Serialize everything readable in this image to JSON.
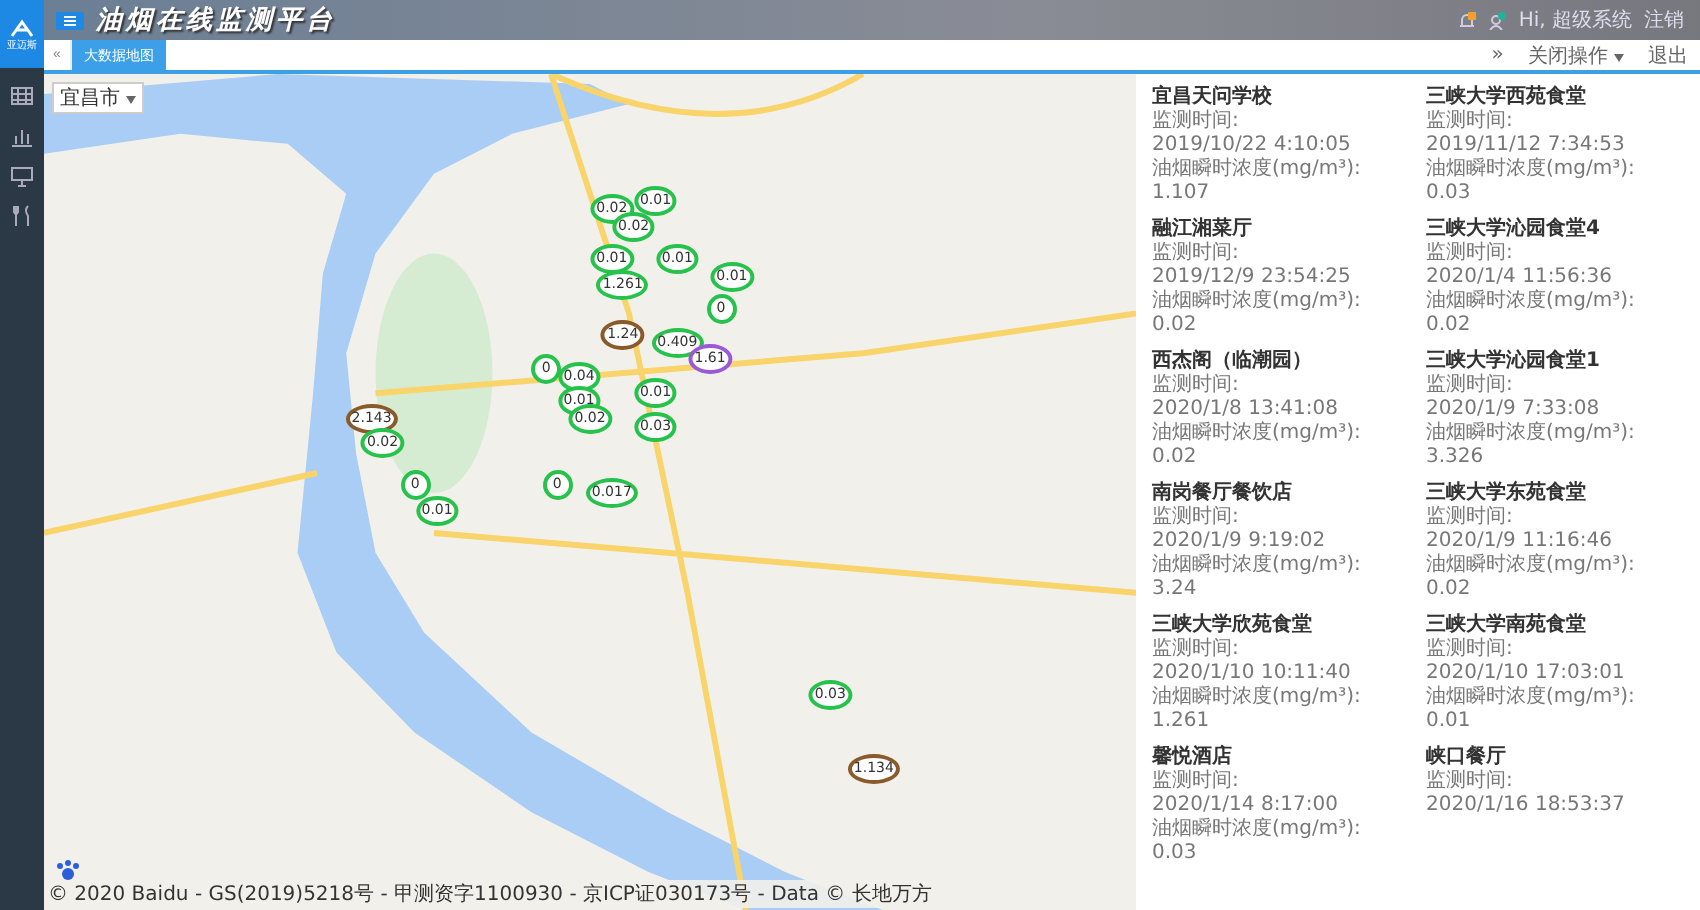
{
  "header": {
    "logo_text": "亚迈斯",
    "title": "油烟在线监测平台",
    "user": "Hi, 超级系统",
    "logout": "注销"
  },
  "tabbar": {
    "collapse": "«",
    "tabs": [
      {
        "label": "大数据地图",
        "selected": true
      }
    ],
    "forward": "»",
    "close_menu": "关闭操作",
    "exit": "退出"
  },
  "map": {
    "city_select": "宜昌市",
    "markers": [
      {
        "value": "0.02",
        "kind": "normal"
      },
      {
        "value": "0.01",
        "kind": "normal"
      },
      {
        "value": "0.02",
        "kind": "normal"
      },
      {
        "value": "0.01",
        "kind": "normal"
      },
      {
        "value": "1.261",
        "kind": "normal"
      },
      {
        "value": "0.01",
        "kind": "normal"
      },
      {
        "value": "0.01",
        "kind": "normal"
      },
      {
        "value": "0",
        "kind": "normal"
      },
      {
        "value": "1.24",
        "kind": "alert"
      },
      {
        "value": "0.409",
        "kind": "normal"
      },
      {
        "value": "1.61",
        "kind": "purple"
      },
      {
        "value": "0",
        "kind": "normal"
      },
      {
        "value": "0.04",
        "kind": "normal"
      },
      {
        "value": "0.01",
        "kind": "normal"
      },
      {
        "value": "0.02",
        "kind": "normal"
      },
      {
        "value": "0.01",
        "kind": "normal"
      },
      {
        "value": "0.03",
        "kind": "normal"
      },
      {
        "value": "2.143",
        "kind": "alert"
      },
      {
        "value": "0.02",
        "kind": "normal"
      },
      {
        "value": "0",
        "kind": "normal"
      },
      {
        "value": "0.01",
        "kind": "normal"
      },
      {
        "value": "0",
        "kind": "normal"
      },
      {
        "value": "0.017",
        "kind": "normal"
      },
      {
        "value": "0.03",
        "kind": "normal"
      },
      {
        "value": "1.134",
        "kind": "alert"
      }
    ],
    "copyright": "© 2020 Baidu - GS(2019)5218号 - 甲测资字1100930 - 京ICP证030173号 - Data © 长地万方"
  },
  "panel": {
    "items": [
      {
        "name": "宜昌天问学校",
        "time_label": "监测时间:",
        "time": "2019/10/22 4:10:05",
        "conc_label": "油烟瞬时浓度(mg/m³):",
        "conc": "1.107"
      },
      {
        "name": "三峡大学西苑食堂",
        "time_label": "监测时间:",
        "time": "2019/11/12 7:34:53",
        "conc_label": "油烟瞬时浓度(mg/m³):",
        "conc": "0.03"
      },
      {
        "name": "融江湘菜厅",
        "time_label": "监测时间:",
        "time": "2019/12/9 23:54:25",
        "conc_label": "油烟瞬时浓度(mg/m³):",
        "conc": "0.02"
      },
      {
        "name": "三峡大学沁园食堂4",
        "time_label": "监测时间:",
        "time": "2020/1/4 11:56:36",
        "conc_label": "油烟瞬时浓度(mg/m³):",
        "conc": "0.02"
      },
      {
        "name": "西杰阁（临潮园）",
        "time_label": "监测时间:",
        "time": "2020/1/8 13:41:08",
        "conc_label": "油烟瞬时浓度(mg/m³):",
        "conc": "0.02"
      },
      {
        "name": "三峡大学沁园食堂1",
        "time_label": "监测时间:",
        "time": "2020/1/9 7:33:08",
        "conc_label": "油烟瞬时浓度(mg/m³):",
        "conc": "3.326"
      },
      {
        "name": "南岗餐厅餐饮店",
        "time_label": "监测时间:",
        "time": "2020/1/9 9:19:02",
        "conc_label": "油烟瞬时浓度(mg/m³):",
        "conc": "3.24"
      },
      {
        "name": "三峡大学东苑食堂",
        "time_label": "监测时间:",
        "time": "2020/1/9 11:16:46",
        "conc_label": "油烟瞬时浓度(mg/m³):",
        "conc": "0.02"
      },
      {
        "name": "三峡大学欣苑食堂",
        "time_label": "监测时间:",
        "time": "2020/1/10 10:11:40",
        "conc_label": "油烟瞬时浓度(mg/m³):",
        "conc": "1.261"
      },
      {
        "name": "三峡大学南苑食堂",
        "time_label": "监测时间:",
        "time": "2020/1/10 17:03:01",
        "conc_label": "油烟瞬时浓度(mg/m³):",
        "conc": "0.01"
      },
      {
        "name": "馨悦酒店",
        "time_label": "监测时间:",
        "time": "2020/1/14 8:17:00",
        "conc_label": "油烟瞬时浓度(mg/m³):",
        "conc": "0.03"
      },
      {
        "name": "峡口餐厅",
        "time_label": "监测时间:",
        "time": "2020/1/16 18:53:37"
      }
    ]
  }
}
